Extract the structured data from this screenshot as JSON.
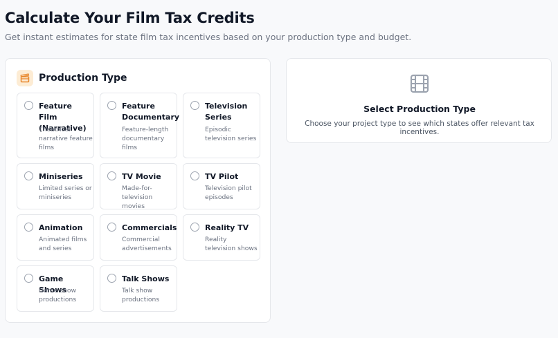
{
  "header": {
    "title": "Calculate Your Film Tax Credits",
    "subtitle": "Get instant estimates for state film tax incentives based on your production type and budget."
  },
  "production_panel": {
    "title": "Production Type",
    "icon": "clapperboard-icon",
    "accent_color": "#e8872c",
    "types": [
      {
        "name": "Feature Film (Narrative)",
        "description": "Theatrical narrative feature films"
      },
      {
        "name": "Feature Documentary",
        "description": "Feature-length documentary films"
      },
      {
        "name": "Television Series",
        "description": "Episodic television series"
      },
      {
        "name": "Miniseries",
        "description": "Limited series or miniseries"
      },
      {
        "name": "TV Movie",
        "description": "Made-for-television movies"
      },
      {
        "name": "TV Pilot",
        "description": "Television pilot episodes"
      },
      {
        "name": "Animation",
        "description": "Animated films and series"
      },
      {
        "name": "Commercials",
        "description": "Commercial advertisements"
      },
      {
        "name": "Reality TV",
        "description": "Reality television shows"
      },
      {
        "name": "Game Shows",
        "description": "Game show productions"
      },
      {
        "name": "Talk Shows",
        "description": "Talk show productions"
      }
    ]
  },
  "result_panel": {
    "icon": "film-icon",
    "title": "Select Production Type",
    "description": "Choose your project type to see which states offer relevant tax incentives."
  }
}
